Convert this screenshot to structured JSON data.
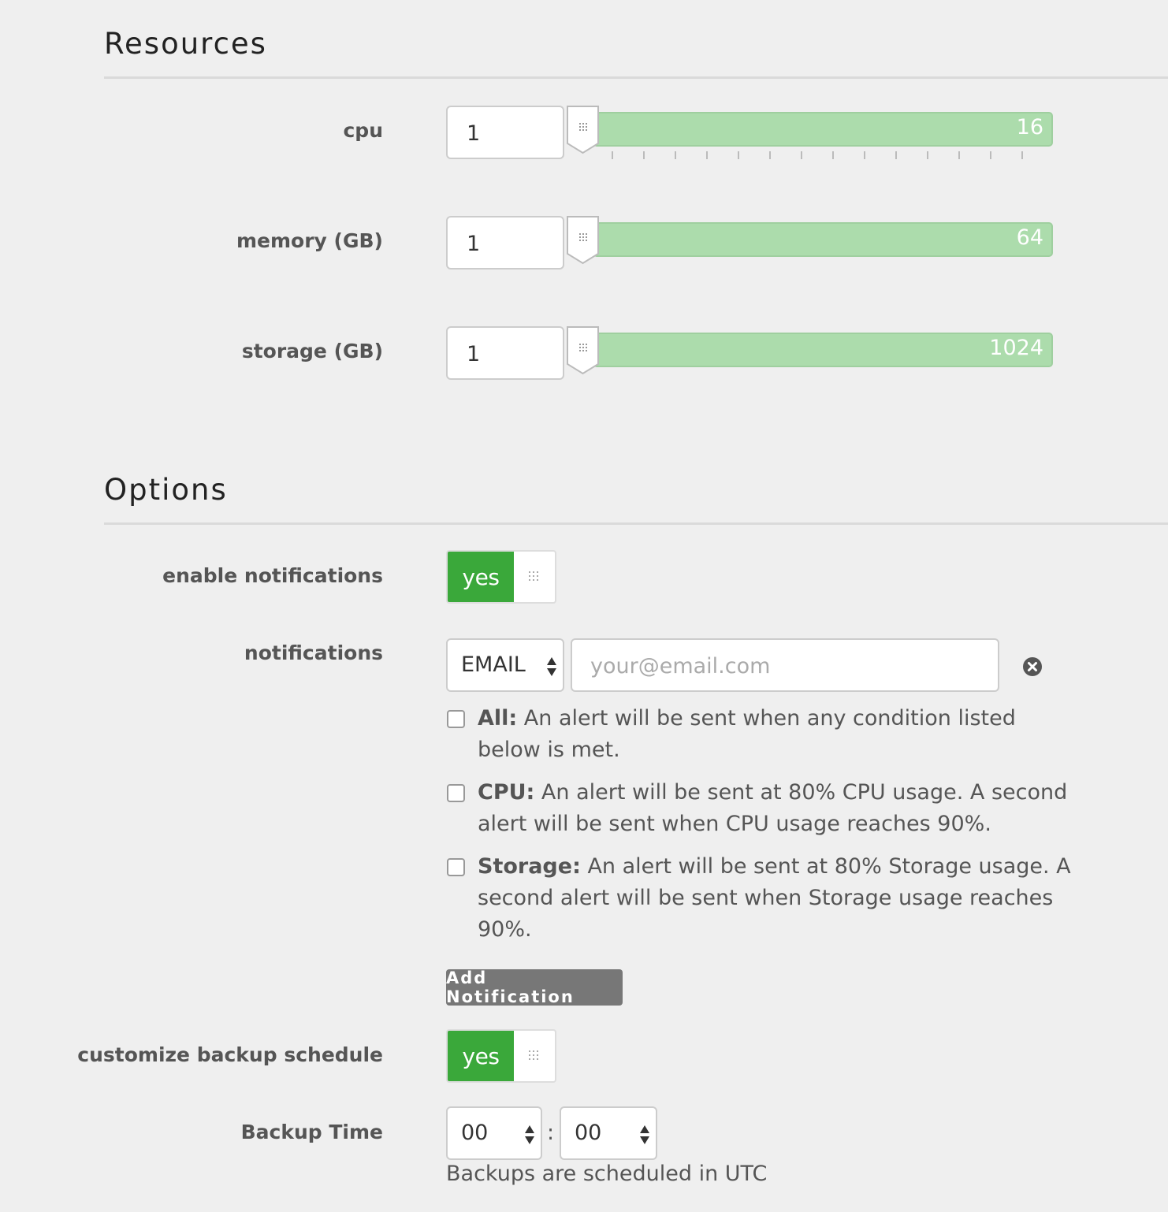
{
  "colors": {
    "accent_green": "#3aa83a",
    "slider_fill": "#acdcac",
    "button_gray": "#777777",
    "background": "#efefef"
  },
  "resources": {
    "title": "Resources",
    "sliders": [
      {
        "label": "cpu",
        "value": "1",
        "max": "16",
        "has_ticks": true,
        "tick_count": 14
      },
      {
        "label": "memory (GB)",
        "value": "1",
        "max": "64",
        "has_ticks": false
      },
      {
        "label": "storage (GB)",
        "value": "1",
        "max": "1024",
        "has_ticks": false
      }
    ]
  },
  "options": {
    "title": "Options",
    "enable_notifications": {
      "label": "enable notifications",
      "toggle_label": "yes",
      "on": true
    },
    "notifications": {
      "label": "notifications",
      "channel_select": "EMAIL",
      "email_placeholder": "your@email.com",
      "remove_icon": "close-circle-icon",
      "checks": [
        {
          "title": "All:",
          "text": " An alert will be sent when any condition listed below is met.",
          "checked": false
        },
        {
          "title": "CPU:",
          "text": " An alert will be sent at 80% CPU usage. A second alert will be sent when CPU usage reaches 90%.",
          "checked": false
        },
        {
          "title": "Storage:",
          "text": " An alert will be sent at 80% Storage usage. A second alert will be sent when Storage usage reaches 90%.",
          "checked": false
        }
      ],
      "add_button": "Add Notification"
    },
    "backup_schedule": {
      "label": "customize backup schedule",
      "toggle_label": "yes",
      "on": true
    },
    "backup_time": {
      "label": "Backup Time",
      "hour": "00",
      "separator": ":",
      "minute": "00",
      "hint": "Backups are scheduled in UTC"
    }
  }
}
